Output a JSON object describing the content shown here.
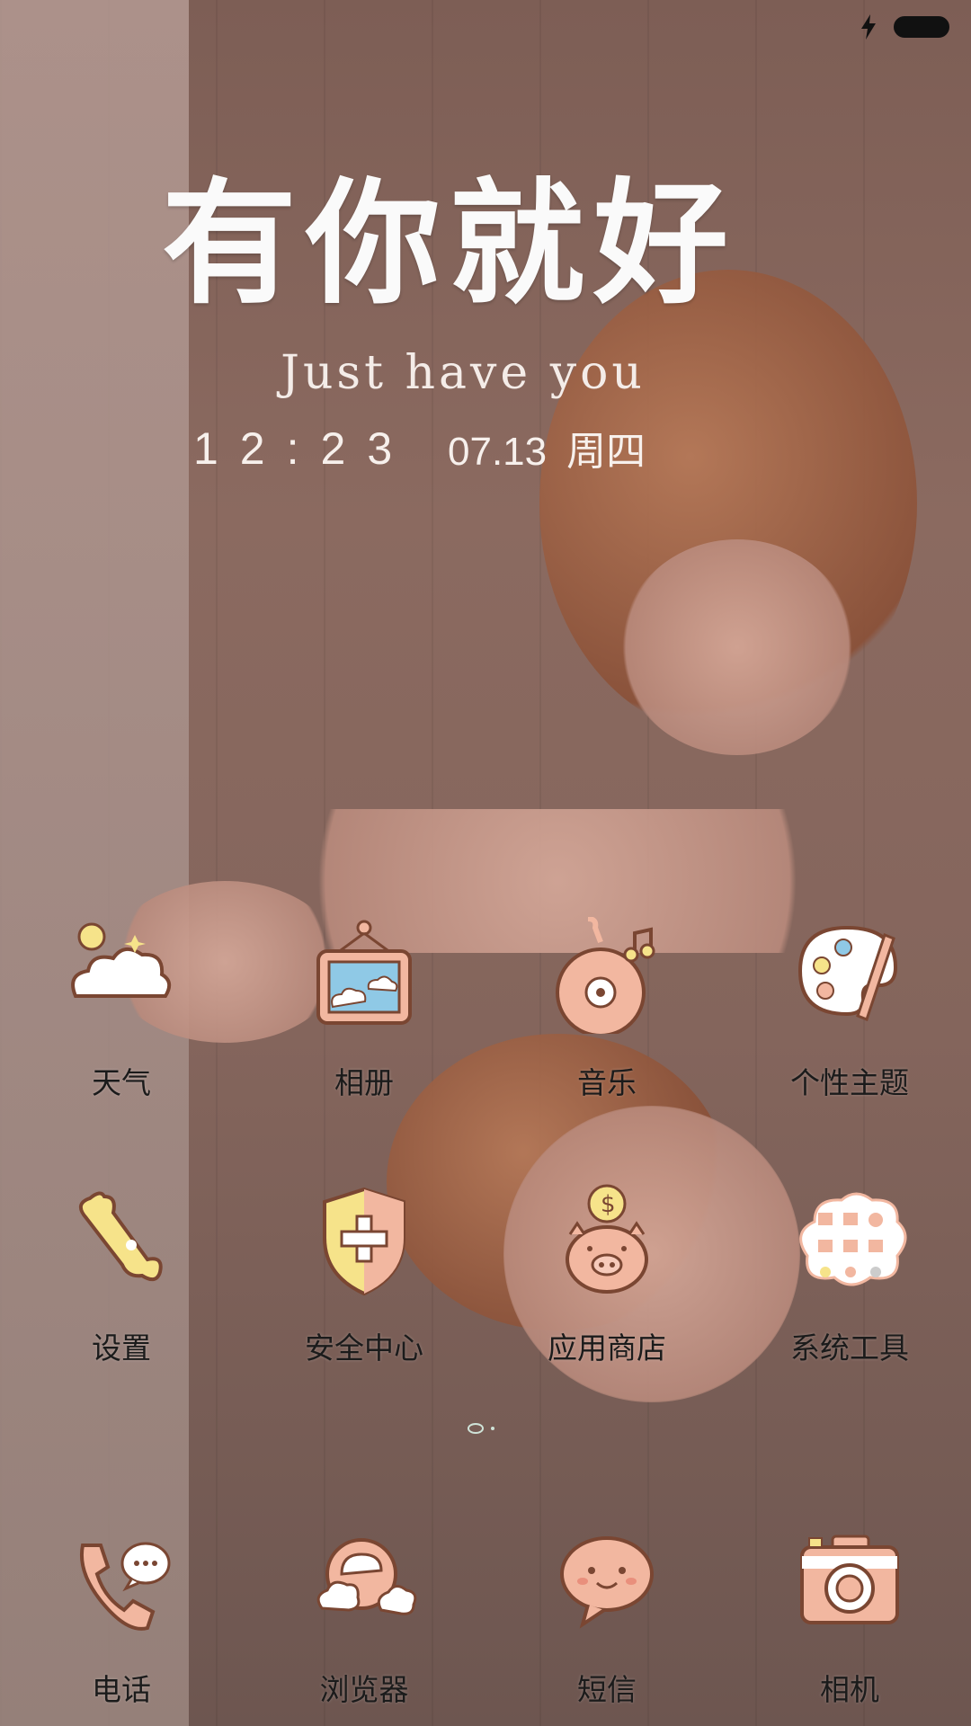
{
  "status_bar": {
    "icons": [
      "charging-bolt-icon",
      "battery-icon"
    ],
    "colors": {
      "icon": "#111111"
    }
  },
  "widget": {
    "title": "有你就好",
    "subtitle": "Just have you",
    "time": "12:23",
    "date": "07.13",
    "weekday": "周四"
  },
  "apps_row1": [
    {
      "label": "天气",
      "icon": "weather-icon"
    },
    {
      "label": "相册",
      "icon": "gallery-icon"
    },
    {
      "label": "音乐",
      "icon": "music-icon"
    },
    {
      "label": "个性主题",
      "icon": "themes-icon"
    }
  ],
  "apps_row2": [
    {
      "label": "设置",
      "icon": "settings-icon"
    },
    {
      "label": "安全中心",
      "icon": "security-center-icon"
    },
    {
      "label": "应用商店",
      "icon": "app-store-icon"
    },
    {
      "label": "系统工具",
      "icon": "system-tools-icon"
    }
  ],
  "dock": [
    {
      "label": "电话",
      "icon": "phone-icon"
    },
    {
      "label": "浏览器",
      "icon": "browser-icon"
    },
    {
      "label": "短信",
      "icon": "messages-icon"
    },
    {
      "label": "相机",
      "icon": "camera-icon"
    }
  ],
  "colors": {
    "icon_peach": "#f2b7a0",
    "icon_outline": "#7a4632",
    "icon_yellow": "#f6e38a",
    "icon_blue": "#8fc9e6",
    "label_text": "#1b1b1b",
    "widget_text": "#f7f0ec"
  }
}
